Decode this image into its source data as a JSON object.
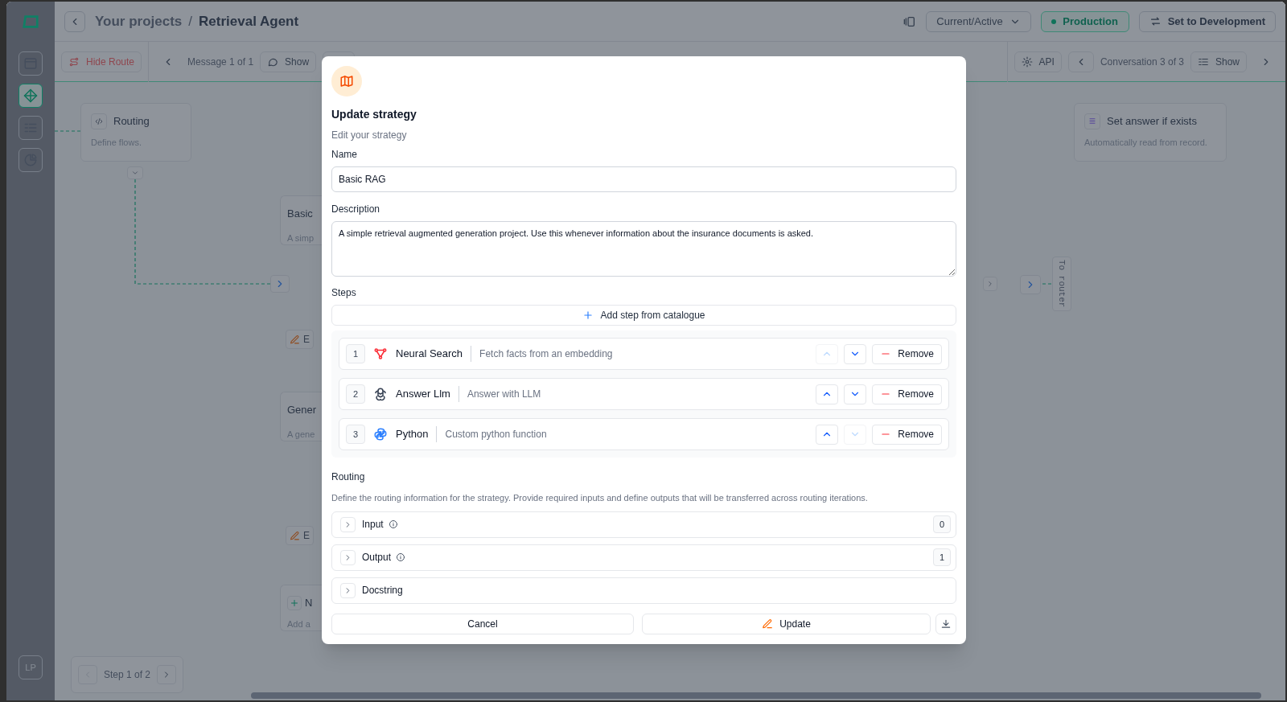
{
  "sidebar": {
    "items": [
      {
        "kind": "window",
        "selected": false
      },
      {
        "kind": "flow",
        "selected": true
      },
      {
        "kind": "list",
        "selected": false
      },
      {
        "kind": "chart",
        "selected": false
      }
    ],
    "avatar": "LP"
  },
  "header": {
    "breadcrumb_parent": "Your projects",
    "separator": "/",
    "title": "Retrieval Agent",
    "version_select": "Current/Active",
    "environment": "Production",
    "switch_button": "Set to Development"
  },
  "toolbar_left": {
    "route_button": "Hide Route",
    "message_pager": "Message 1 of 1",
    "show_button": "Show"
  },
  "toolbar_right": {
    "api_button": "API",
    "conversation_pager": "Conversation 3 of 3",
    "show_button": "Show"
  },
  "canvas": {
    "nodes": [
      {
        "kind": "code",
        "title": "Routing",
        "description": "Define flows."
      },
      {
        "kind": "list",
        "title": "Set answer if exists",
        "description": "Automatically read from record."
      }
    ],
    "partial_nodes": [
      {
        "kind": "strategy",
        "title": "Basic",
        "description": "A simp",
        "edit": "E"
      },
      {
        "kind": "strategy",
        "title": "Gener",
        "description": "A gene",
        "edit": "E"
      },
      {
        "kind": "add",
        "title": "N",
        "description": "Add a"
      }
    ],
    "router_label": "To router",
    "step_pager": "Step 1 of 2"
  },
  "modal": {
    "title": "Update strategy",
    "subtitle": "Edit your strategy",
    "name_label": "Name",
    "name_value": "Basic RAG",
    "description_label": "Description",
    "description_value": "A simple retrieval augmented generation project. Use this whenever information about the insurance documents is asked.",
    "steps_label": "Steps",
    "add_step": "Add step from catalogue",
    "steps": [
      {
        "number": "1",
        "kind": "search",
        "name": "Neural Search",
        "description": "Fetch facts from an embedding",
        "up_disabled": true,
        "down_disabled": false,
        "remove": "Remove"
      },
      {
        "number": "2",
        "kind": "llm",
        "name": "Answer Llm",
        "description": "Answer with LLM",
        "up_disabled": false,
        "down_disabled": false,
        "remove": "Remove"
      },
      {
        "number": "3",
        "kind": "python",
        "name": "Python",
        "description": "Custom python function",
        "up_disabled": false,
        "down_disabled": true,
        "remove": "Remove"
      }
    ],
    "routing_label": "Routing",
    "routing_help": "Define the routing information for the strategy. Provide required inputs and define outputs that will be transferred across routing iterations.",
    "sections": [
      {
        "label": "Input",
        "info": true,
        "count": "0",
        "expanded": false
      },
      {
        "label": "Output",
        "info": true,
        "count": "1",
        "expanded": false
      },
      {
        "label": "Docstring",
        "info": false,
        "expanded": false
      }
    ],
    "cancel": "Cancel",
    "update": "Update"
  }
}
